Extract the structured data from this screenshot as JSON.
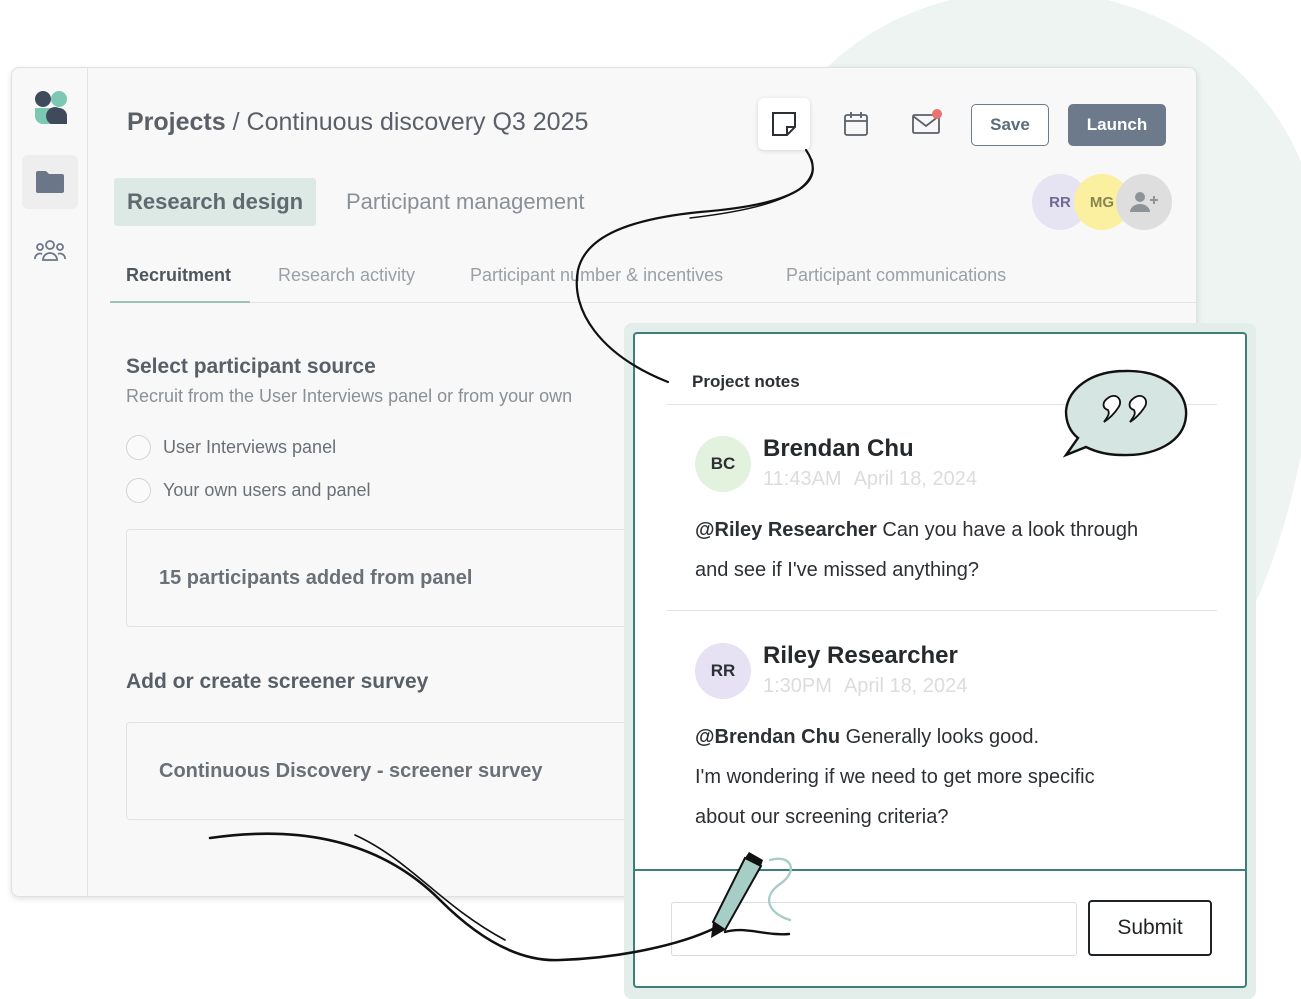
{
  "header": {
    "breadcrumb_root": "Projects",
    "breadcrumb_separator": " / ",
    "project_name": "Continuous discovery Q3 2025",
    "save_label": "Save",
    "launch_label": "Launch"
  },
  "sidebar": {
    "items": [
      {
        "icon": "logo-icon"
      },
      {
        "icon": "folder-icon",
        "active": true
      },
      {
        "icon": "people-icon"
      }
    ]
  },
  "main_tabs": [
    {
      "label": "Research design",
      "active": true
    },
    {
      "label": "Participant management",
      "active": false
    }
  ],
  "collaborators": [
    "RR",
    "MG"
  ],
  "sub_tabs": [
    {
      "label": "Recruitment",
      "active": true
    },
    {
      "label": "Research activity"
    },
    {
      "label": "Participant number & incentives"
    },
    {
      "label": "Participant communications"
    }
  ],
  "participant_source": {
    "title": "Select participant source",
    "subtitle": "Recruit from the User Interviews panel or from your own",
    "options": [
      "User Interviews panel",
      "Your own users and panel"
    ],
    "summary": "15 participants added from panel"
  },
  "screener": {
    "title": "Add or create screener survey",
    "survey_name": "Continuous Discovery - screener survey"
  },
  "notes": {
    "title": "Project notes",
    "comments": [
      {
        "initials": "BC",
        "author": "Brendan Chu",
        "time": "11:43AM",
        "date": "April 18, 2024",
        "mention": "@Riley Researcher",
        "text_lines": [
          " Can you have a look through",
          "and see if I've missed anything?"
        ]
      },
      {
        "initials": "RR",
        "author": "Riley Researcher",
        "time": "1:30PM",
        "date": "April 18, 2024",
        "mention": "@Brendan Chu",
        "text_lines": [
          " Generally looks good.",
          "I'm wondering if we need to get more specific",
          "about our screening criteria?"
        ]
      }
    ],
    "reply_value": "",
    "submit_label": "Submit"
  },
  "colors": {
    "accent_teal": "#3e7f7a",
    "launch_bg": "#6d7a8b",
    "mail_badge": "#e8736f"
  }
}
